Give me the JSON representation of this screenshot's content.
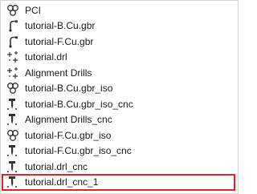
{
  "items": [
    {
      "label": "PCI",
      "icon": "geometry-icon"
    },
    {
      "label": "tutorial-B.Cu.gbr",
      "icon": "gerber-icon"
    },
    {
      "label": "tutorial-F.Cu.gbr",
      "icon": "gerber-icon"
    },
    {
      "label": "tutorial.drl",
      "icon": "excellon-icon"
    },
    {
      "label": "Alignment Drills",
      "icon": "excellon-icon"
    },
    {
      "label": "tutorial-B.Cu.gbr_iso",
      "icon": "geometry-icon"
    },
    {
      "label": "tutorial-B.Cu.gbr_iso_cnc",
      "icon": "cnc-icon"
    },
    {
      "label": "Alignment Drills_cnc",
      "icon": "cnc-icon"
    },
    {
      "label": "tutorial-F.Cu.gbr_iso",
      "icon": "geometry-icon"
    },
    {
      "label": "tutorial-F.Cu.gbr_iso_cnc",
      "icon": "cnc-icon"
    },
    {
      "label": "tutorial.drl_cnc",
      "icon": "cnc-icon"
    },
    {
      "label": "tutorial.drl_cnc_1",
      "icon": "cnc-icon",
      "selected": true
    }
  ],
  "colors": {
    "highlight_border": "#e0242b",
    "text": "#1a1a1a"
  }
}
